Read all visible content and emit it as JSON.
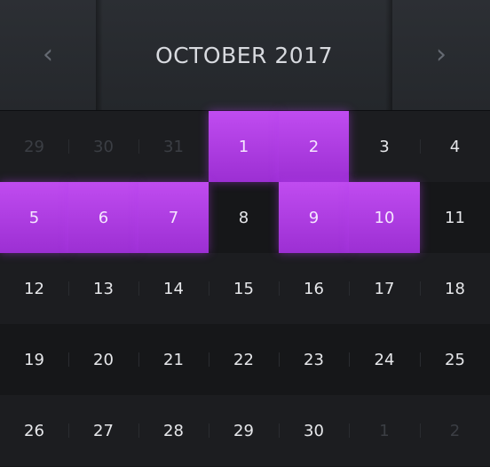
{
  "header": {
    "title": "OCTOBER 2017",
    "prev_icon": "‹",
    "next_icon": "›"
  },
  "colors": {
    "selected": "#b13ee6",
    "background": "#151618",
    "header": "#282b30"
  },
  "weeks": [
    {
      "days": [
        {
          "label": "29",
          "other": true,
          "selected": false
        },
        {
          "label": "30",
          "other": true,
          "selected": false
        },
        {
          "label": "31",
          "other": true,
          "selected": false
        },
        {
          "label": "1",
          "other": false,
          "selected": true
        },
        {
          "label": "2",
          "other": false,
          "selected": true
        },
        {
          "label": "3",
          "other": false,
          "selected": false
        },
        {
          "label": "4",
          "other": false,
          "selected": false
        }
      ]
    },
    {
      "days": [
        {
          "label": "5",
          "other": false,
          "selected": true
        },
        {
          "label": "6",
          "other": false,
          "selected": true
        },
        {
          "label": "7",
          "other": false,
          "selected": true
        },
        {
          "label": "8",
          "other": false,
          "selected": false
        },
        {
          "label": "9",
          "other": false,
          "selected": true
        },
        {
          "label": "10",
          "other": false,
          "selected": true
        },
        {
          "label": "11",
          "other": false,
          "selected": false
        }
      ]
    },
    {
      "days": [
        {
          "label": "12",
          "other": false,
          "selected": false
        },
        {
          "label": "13",
          "other": false,
          "selected": false
        },
        {
          "label": "14",
          "other": false,
          "selected": false
        },
        {
          "label": "15",
          "other": false,
          "selected": false
        },
        {
          "label": "16",
          "other": false,
          "selected": false
        },
        {
          "label": "17",
          "other": false,
          "selected": false
        },
        {
          "label": "18",
          "other": false,
          "selected": false
        }
      ]
    },
    {
      "days": [
        {
          "label": "19",
          "other": false,
          "selected": false
        },
        {
          "label": "20",
          "other": false,
          "selected": false
        },
        {
          "label": "21",
          "other": false,
          "selected": false
        },
        {
          "label": "22",
          "other": false,
          "selected": false
        },
        {
          "label": "23",
          "other": false,
          "selected": false
        },
        {
          "label": "24",
          "other": false,
          "selected": false
        },
        {
          "label": "25",
          "other": false,
          "selected": false
        }
      ]
    },
    {
      "days": [
        {
          "label": "26",
          "other": false,
          "selected": false
        },
        {
          "label": "27",
          "other": false,
          "selected": false
        },
        {
          "label": "28",
          "other": false,
          "selected": false
        },
        {
          "label": "29",
          "other": false,
          "selected": false
        },
        {
          "label": "30",
          "other": false,
          "selected": false
        },
        {
          "label": "1",
          "other": true,
          "selected": false
        },
        {
          "label": "2",
          "other": true,
          "selected": false
        }
      ]
    }
  ]
}
